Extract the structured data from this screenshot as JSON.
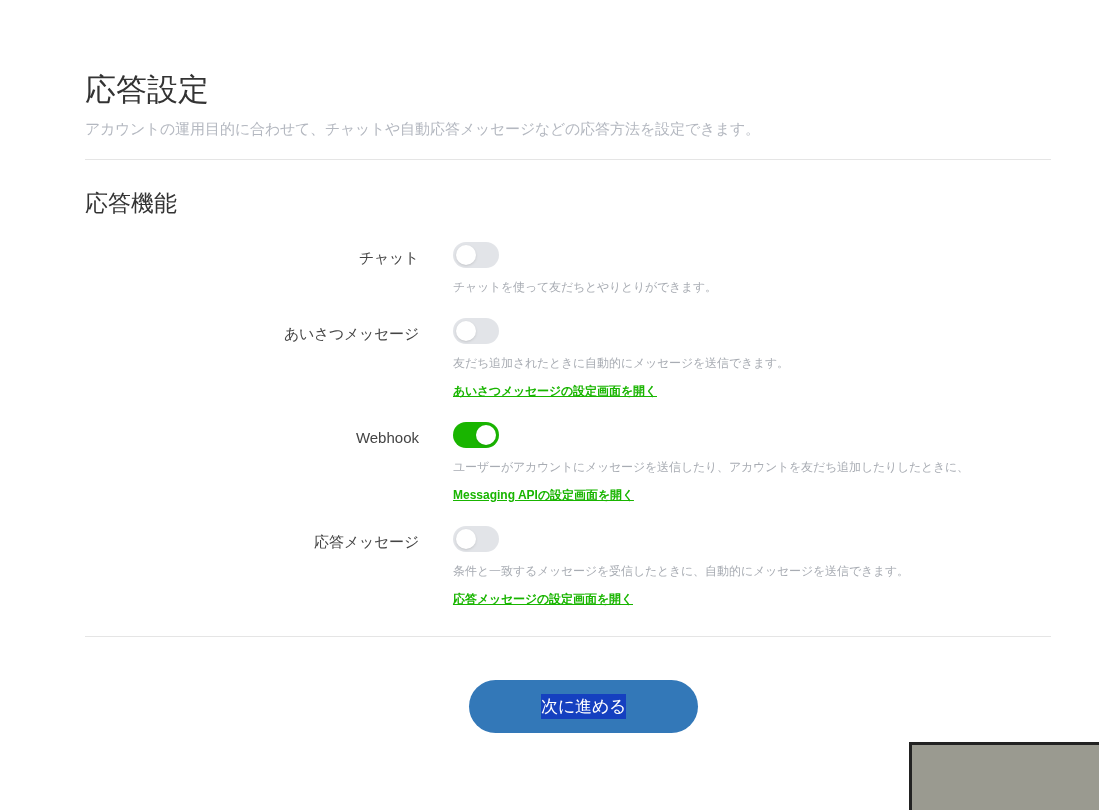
{
  "page": {
    "title": "応答設定",
    "description": "アカウントの運用目的に合わせて、チャットや自動応答メッセージなどの応答方法を設定できます。"
  },
  "section": {
    "title": "応答機能"
  },
  "settings": [
    {
      "label": "チャット",
      "on": false,
      "description": "チャットを使って友だちとやりとりができます。"
    },
    {
      "label": "あいさつメッセージ",
      "on": false,
      "description": "友だち追加されたときに自動的にメッセージを送信できます。",
      "link": "あいさつメッセージの設定画面を開く"
    },
    {
      "label": "Webhook",
      "on": true,
      "description": "ユーザーがアカウントにメッセージを送信したり、アカウントを友だち追加したりしたときに、",
      "link": "Messaging APIの設定画面を開く"
    },
    {
      "label": "応答メッセージ",
      "on": false,
      "description": "条件と一致するメッセージを受信したときに、自動的にメッセージを送信できます。",
      "link": "応答メッセージの設定画面を開く"
    }
  ],
  "next_button": {
    "label": "次に進める",
    "text_selected": true
  }
}
